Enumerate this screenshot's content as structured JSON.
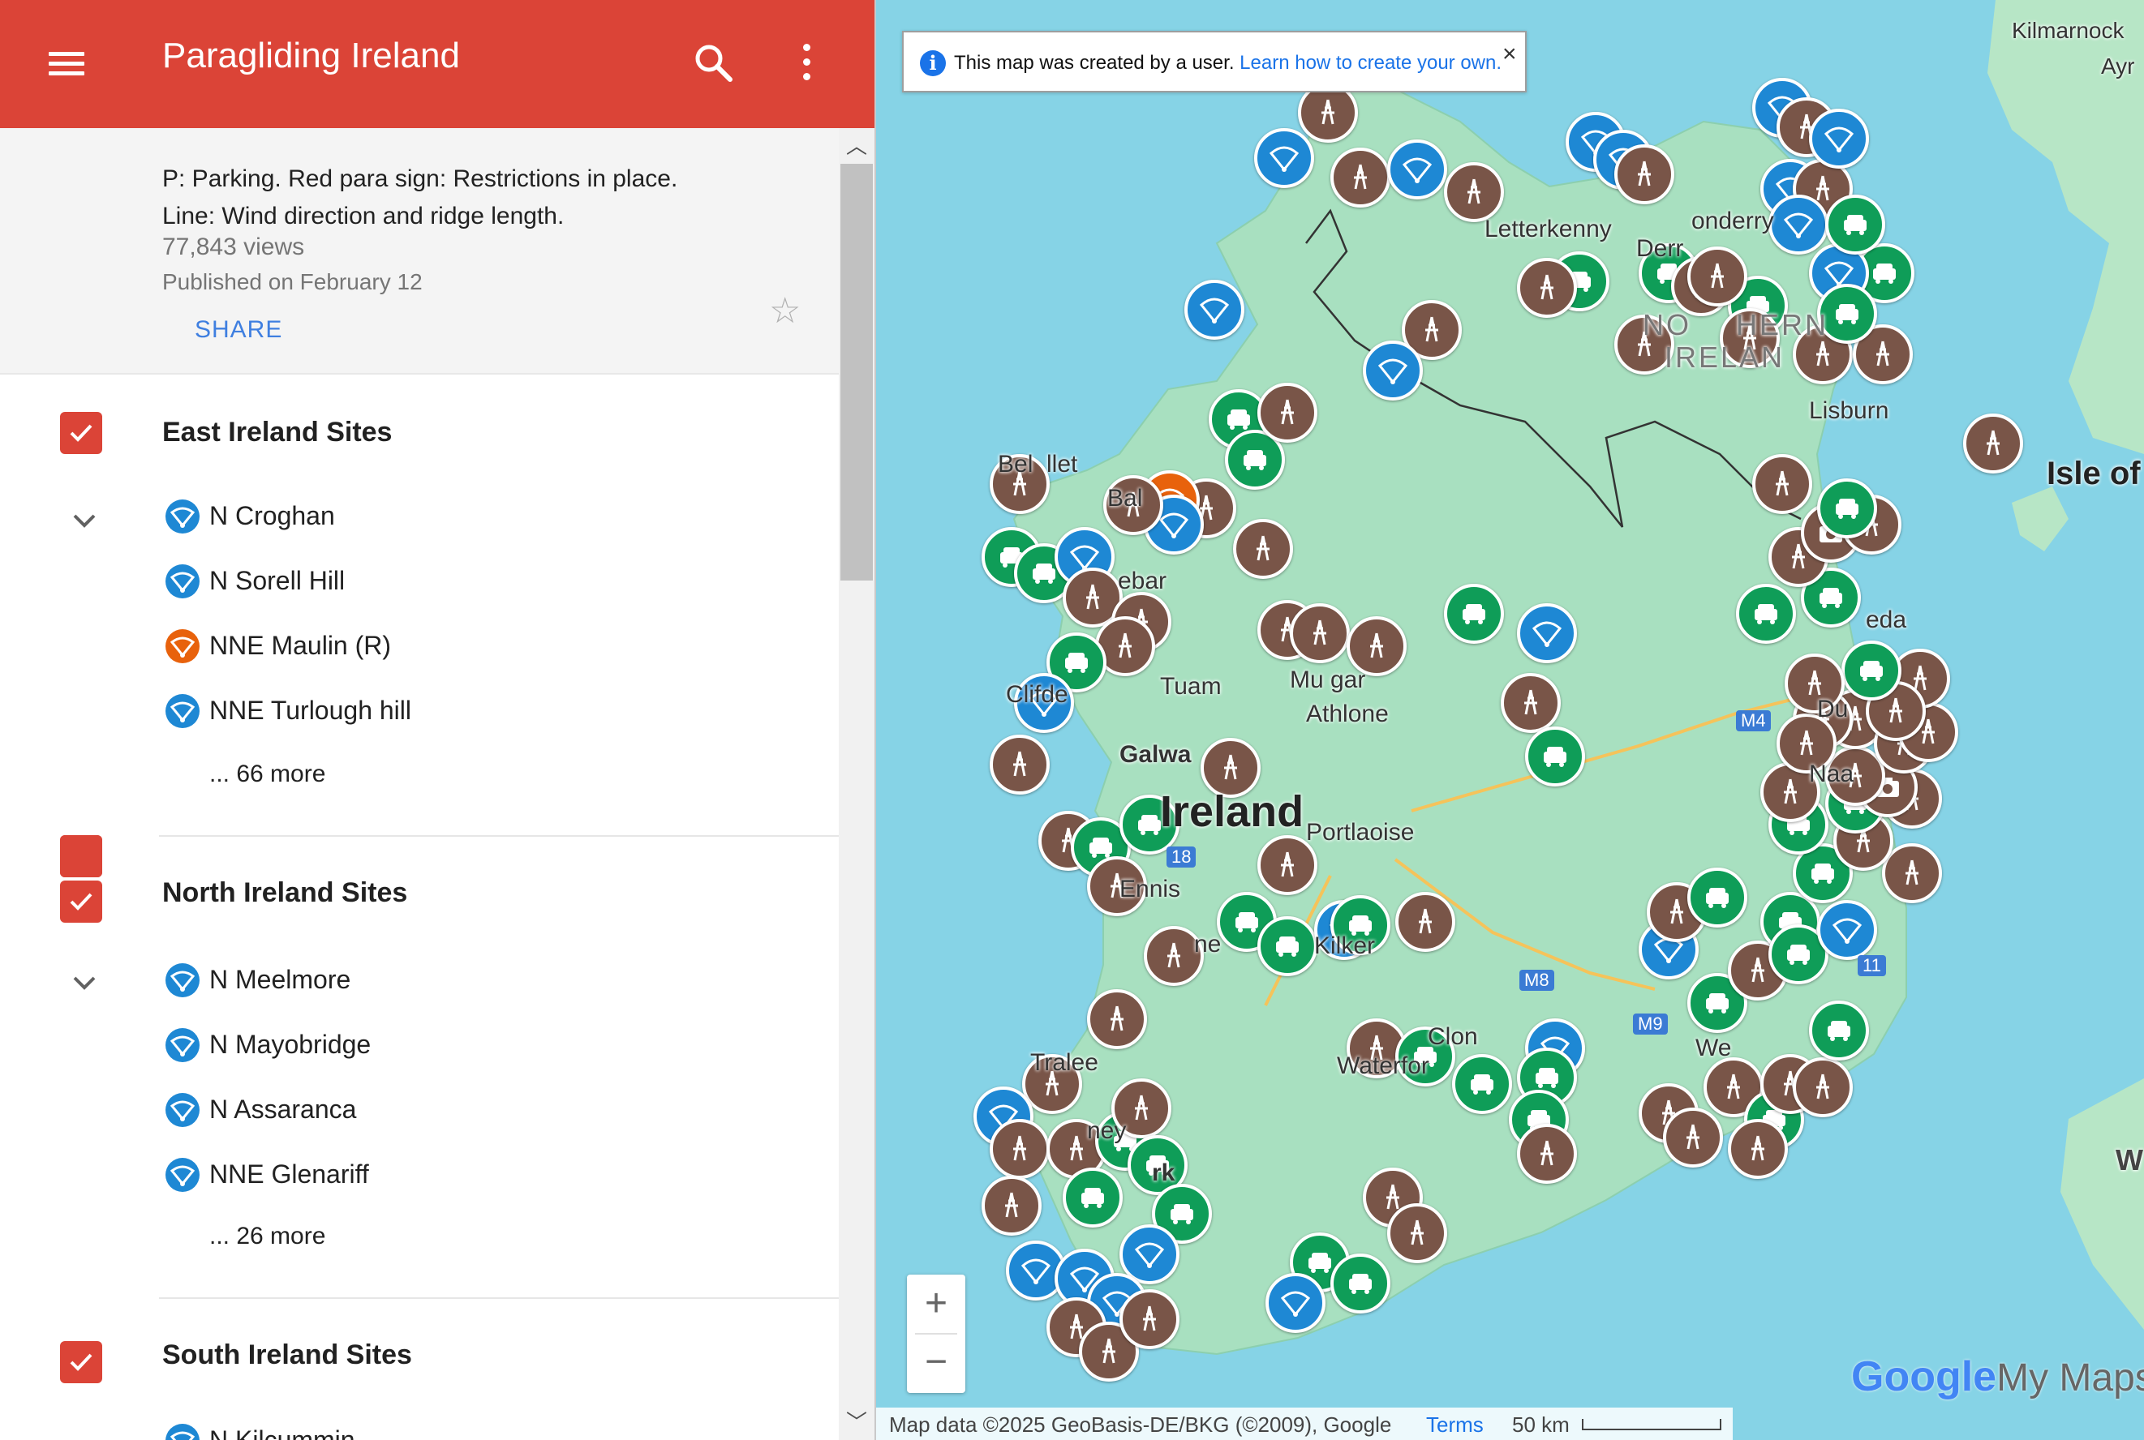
{
  "app": {
    "title": "Paragliding Ireland"
  },
  "info": {
    "description_1": "P: Parking. Red para sign: Restrictions in place.",
    "description_2": "Line: Wind direction and ridge length.",
    "views": "77,843 views",
    "published": "Published on February 12",
    "share_label": "SHARE"
  },
  "layers": [
    {
      "title": "East Ireland Sites",
      "checked": true,
      "sites": [
        {
          "name": "N Croghan",
          "icon": "paraglider-icon",
          "color": "#1e88d4"
        },
        {
          "name": "N Sorell Hill",
          "icon": "paraglider-icon",
          "color": "#1e88d4"
        },
        {
          "name": "NNE Maulin (R)",
          "icon": "paraglider-icon",
          "color": "#e8620c"
        },
        {
          "name": "NNE Turlough hill",
          "icon": "paraglider-icon",
          "color": "#1e88d4"
        }
      ],
      "more": "... 66 more"
    },
    {
      "title": "North Ireland Sites",
      "checked": true,
      "sites": [
        {
          "name": "N Meelmore",
          "icon": "paraglider-icon",
          "color": "#1e88d4"
        },
        {
          "name": "N Mayobridge",
          "icon": "paraglider-icon",
          "color": "#1e88d4"
        },
        {
          "name": "N Assaranca",
          "icon": "paraglider-icon",
          "color": "#1e88d4"
        },
        {
          "name": "NNE Glenariff",
          "icon": "paraglider-icon",
          "color": "#1e88d4"
        }
      ],
      "more": "... 26 more"
    },
    {
      "title": "South Ireland Sites",
      "checked": true,
      "sites": [
        {
          "name": "N Kilcummin",
          "icon": "paraglider-icon",
          "color": "#1e88d4"
        }
      ]
    }
  ],
  "map": {
    "notice_text": "This map was created by a user.",
    "notice_link": "Learn how to create your own.",
    "labels": {
      "ireland": "Ireland",
      "isle_of_man": "Isle of",
      "kilmarnock": "Kilmarnock",
      "ayr": "Ayr",
      "letterkenny": "Letterkenny",
      "derry": "Derr",
      "londonderry": "onderry",
      "northern_1": "NO",
      "northern_2": "HERN",
      "ireland_ni": "IRELAN",
      "lisburn": "Lisburn",
      "belmullet": "Bel",
      "belmullet_2": "llet",
      "ballina": "Bal",
      "castlebar": "ebar",
      "tuam": "Tuam",
      "clifden": "Clifde",
      "athlone": "Athlone",
      "mullingar": "Mu",
      "mullingar_2": "gar",
      "galway": "Galwa",
      "portlaoise": "Portlaoise",
      "naas": "Naa",
      "ennis": "Ennis",
      "limerick": "ne",
      "kilkenny": "Kilker",
      "tralee": "Tralee",
      "killarney": "ney",
      "clonmel": "Clon",
      "waterford": "Waterfor",
      "wexford": "We",
      "cork": "rk",
      "wales": "W",
      "dublin": "Du",
      "drogheda": "eda",
      "m4": "M4",
      "m8": "M8",
      "m9": "M9",
      "m18": "18",
      "m11": "11"
    },
    "footer_data": "Map data ©2025 GeoBasis-DE/BKG (©2009), Google",
    "footer_terms": "Terms",
    "footer_scale": "50 km",
    "logo_google": "Google",
    "logo_mymaps": "My Maps",
    "colors": {
      "site": "#1e88d4",
      "parking": "#0f9d58",
      "restricted": "#e8620c",
      "launch": "#795548"
    }
  }
}
